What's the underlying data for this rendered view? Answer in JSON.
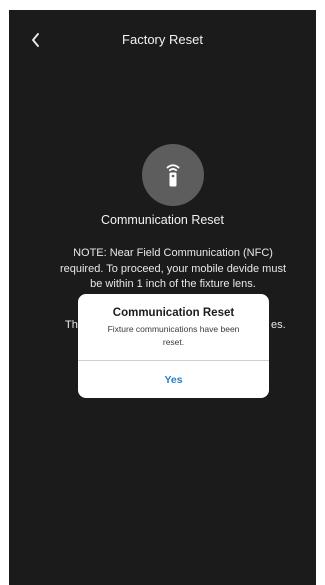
{
  "header": {
    "title": "Factory Reset",
    "back_icon": "chevron-left-icon"
  },
  "main": {
    "icon": "remote-control-icon",
    "section_title": "Communication Reset",
    "note": "NOTE: Near Field Communication (NFC) required. To proceed, your mobile devide must be within 1 inch of the fixture lens.",
    "obscured_text_left": "Th",
    "obscured_text_right": "es."
  },
  "dialog": {
    "title": "Communication Reset",
    "message": "Fixture communications have been reset.",
    "confirm_label": "Yes"
  },
  "colors": {
    "background": "#1b1b1b",
    "icon_circle": "#5d5d5d",
    "dialog_button": "#2a7fc8"
  }
}
